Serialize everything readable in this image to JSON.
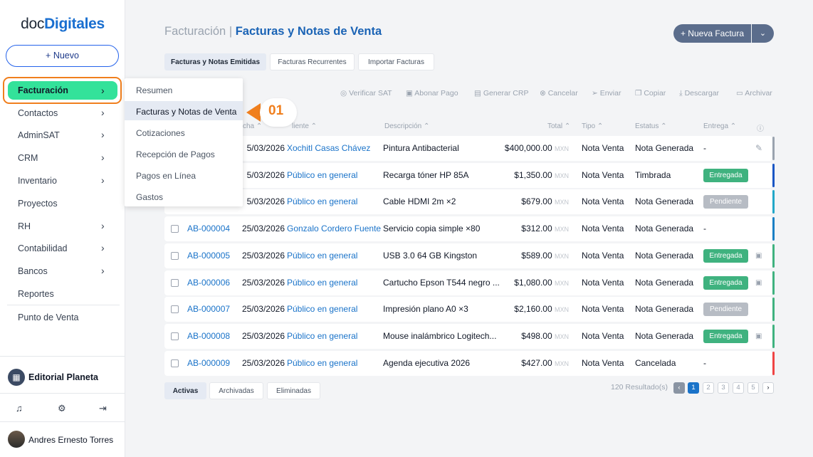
{
  "sidebar": {
    "logo_prefix": "doc",
    "logo_suffix": "Digitales",
    "new_button": "+ Nuevo",
    "active_item": "Facturación",
    "items": [
      "Contactos",
      "AdminSAT",
      "CRM",
      "Inventario",
      "Proyectos",
      "RH",
      "Contabilidad",
      "Bancos",
      "Reportes",
      "Punto de Venta"
    ],
    "org_name": "Editorial Planeta",
    "user_name": "Andres Ernesto Torres"
  },
  "dropdown": {
    "items": [
      "Resumen",
      "Facturas y Notas de Venta",
      "Cotizaciones",
      "Recepción de Pagos",
      "Pagos en Línea",
      "Gastos"
    ],
    "badge": "01"
  },
  "header": {
    "section": "Facturación",
    "sep": "|",
    "title": "Facturas y Notas de Venta",
    "new_button": "+ Nueva Factura"
  },
  "tabs": [
    "Facturas y Notas Emitidas",
    "Facturas Recurrentes",
    "Importar Facturas"
  ],
  "toolbar": [
    "Verificar SAT",
    "Abonar Pago",
    "Generar CRP",
    "Cancelar",
    "Enviar",
    "Copiar",
    "Descargar",
    "Archivar"
  ],
  "columns": {
    "fecha": "cha ⌃",
    "cliente": "liente ⌃",
    "descripcion": "Descripción ⌃",
    "total": "Total ⌃",
    "tipo": "Tipo ⌃",
    "estatus": "Estatus ⌃",
    "entrega": "Entrega ⌃"
  },
  "rows": [
    {
      "folio": "",
      "fecha": "5/03/2026",
      "cliente": "Xochitl Casas Chávez",
      "descripcion": "Pintura Antibacterial",
      "total": "$400,000.00",
      "moneda": "MXN",
      "tipo": "Nota Venta",
      "estatus": "Nota Generada",
      "entrega": "-",
      "entrega_color": "",
      "edge": "#9aa3af"
    },
    {
      "folio": "",
      "fecha": "5/03/2026",
      "cliente": "Público en general",
      "descripcion": "Recarga tóner HP 85A",
      "total": "$1,350.00",
      "moneda": "MXN",
      "tipo": "Nota Venta",
      "estatus": "Timbrada",
      "entrega": "Entregada",
      "entrega_color": "#3fb27f",
      "edge": "#1a56c4"
    },
    {
      "folio": "",
      "fecha": "5/03/2026",
      "cliente": "Público en general",
      "descripcion": "Cable HDMI 2m ×2",
      "total": "$679.00",
      "moneda": "MXN",
      "tipo": "Nota Venta",
      "estatus": "Nota Generada",
      "entrega": "Pendiente",
      "entrega_color": "#b7bcc4",
      "edge": "#22a7c8"
    },
    {
      "folio": "AB-000004",
      "fecha": "25/03/2026",
      "cliente": "Gonzalo Cordero Fuente",
      "descripcion": "Servicio copia simple ×80",
      "total": "$312.00",
      "moneda": "MXN",
      "tipo": "Nota Venta",
      "estatus": "Nota Generada",
      "entrega": "-",
      "entrega_color": "",
      "edge": "#1a7fc4"
    },
    {
      "folio": "AB-000005",
      "fecha": "25/03/2026",
      "cliente": "Público en general",
      "descripcion": "USB 3.0 64 GB Kingston",
      "total": "$589.00",
      "moneda": "MXN",
      "tipo": "Nota Venta",
      "estatus": "Nota Generada",
      "entrega": "Entregada",
      "entrega_color": "#3fb27f",
      "edge": "#3fb27f"
    },
    {
      "folio": "AB-000006",
      "fecha": "25/03/2026",
      "cliente": "Público en general",
      "descripcion": "Cartucho Epson T544 negro ...",
      "total": "$1,080.00",
      "moneda": "MXN",
      "tipo": "Nota Venta",
      "estatus": "Nota Generada",
      "entrega": "Entregada",
      "entrega_color": "#3fb27f",
      "edge": "#3fb27f"
    },
    {
      "folio": "AB-000007",
      "fecha": "25/03/2026",
      "cliente": "Público en general",
      "descripcion": "Impresión plano A0 ×3",
      "total": "$2,160.00",
      "moneda": "MXN",
      "tipo": "Nota Venta",
      "estatus": "Nota Generada",
      "entrega": "Pendiente",
      "entrega_color": "#b7bcc4",
      "edge": "#3fb27f"
    },
    {
      "folio": "AB-000008",
      "fecha": "25/03/2026",
      "cliente": "Público en general",
      "descripcion": "Mouse inalámbrico Logitech...",
      "total": "$498.00",
      "moneda": "MXN",
      "tipo": "Nota Venta",
      "estatus": "Nota Generada",
      "entrega": "Entregada",
      "entrega_color": "#3fb27f",
      "edge": "#3fb27f"
    },
    {
      "folio": "AB-000009",
      "fecha": "25/03/2026",
      "cliente": "Público en general",
      "descripcion": "Agenda ejecutiva 2026",
      "total": "$427.00",
      "moneda": "MXN",
      "tipo": "Nota Venta",
      "estatus": "Cancelada",
      "entrega": "-",
      "entrega_color": "",
      "edge": "#ef4444"
    }
  ],
  "footer": {
    "tabs": [
      "Activas",
      "Archivadas",
      "Eliminadas"
    ],
    "results": "120 Resultado(s)",
    "pages": [
      "1",
      "2",
      "3",
      "4",
      "5"
    ]
  }
}
